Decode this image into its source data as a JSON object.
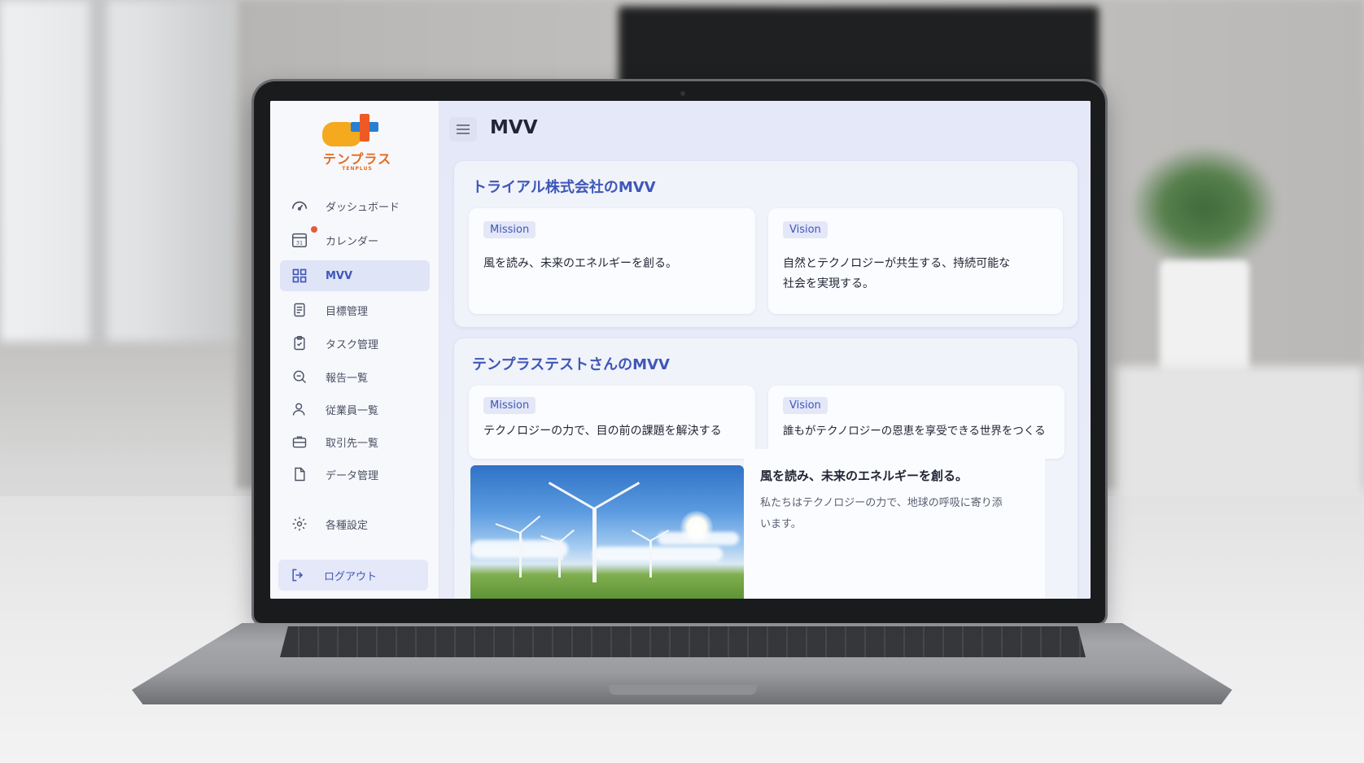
{
  "app": {
    "logo_text": "テンプラス",
    "logo_sub": "TENPLUS"
  },
  "sidebar": {
    "items": [
      {
        "label": "ダッシュボード",
        "icon": "dashboard-gauge-icon"
      },
      {
        "label": "カレンダー",
        "icon": "calendar-icon",
        "icon_text": "31",
        "has_notification_dot": true
      },
      {
        "label": "MVV",
        "icon": "grid-icon",
        "active": true
      },
      {
        "label": "目標管理",
        "icon": "document-list-icon"
      },
      {
        "label": "タスク管理",
        "icon": "clipboard-check-icon"
      },
      {
        "label": "報告一覧",
        "icon": "search-chat-icon"
      },
      {
        "label": "従業員一覧",
        "icon": "person-icon"
      },
      {
        "label": "取引先一覧",
        "icon": "briefcase-icon"
      },
      {
        "label": "データ管理",
        "icon": "file-icon"
      }
    ],
    "settings": {
      "label": "各種設定",
      "icon": "gear-icon"
    },
    "logout": {
      "label": "ログアウト",
      "icon": "logout-icon"
    }
  },
  "header": {
    "title": "MVV",
    "menu_icon": "hamburger-icon"
  },
  "sections": [
    {
      "title": "トライアル株式会社のMVV",
      "mission": {
        "tag": "Mission",
        "text": "風を読み、未来のエネルギーを創る。"
      },
      "vision": {
        "tag": "Vision",
        "text_line1": "自然とテクノロジーが共生する、持続可能な",
        "text_line2": "社会を実現する。"
      }
    },
    {
      "title": "テンプラステストさんのMVV",
      "mission": {
        "tag": "Mission",
        "text": "テクノロジーの力で、目の前の課題を解決する"
      },
      "vision": {
        "tag": "Vision",
        "text": "誰もがテクノロジーの恩恵を享受できる世界をつくる"
      }
    }
  ],
  "feature": {
    "heading": "風を読み、未来のエネルギーを創る。",
    "body_line1": "私たちはテクノロジーの力で、地球の呼吸に寄り添",
    "body_line2": "います。"
  },
  "colors": {
    "accent": "#3f57b8",
    "logo_orange": "#e46b1f",
    "notification": "#e25b3c"
  }
}
